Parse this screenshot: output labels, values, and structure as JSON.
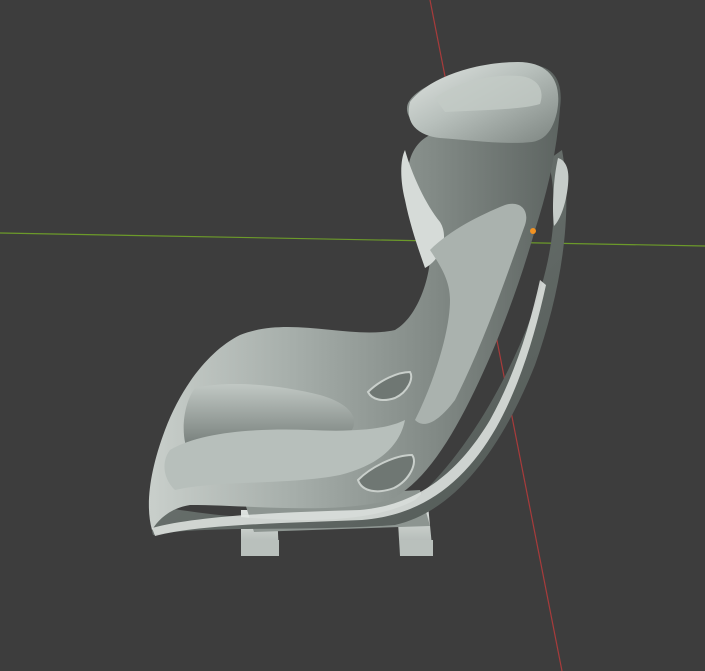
{
  "viewport": {
    "background_color": "#3d3d3d",
    "x_axis_color": "#a83b3b",
    "y_axis_color": "#6c9a2a",
    "origin_color": "#f29222"
  },
  "object": {
    "type": "racing-seat-mesh",
    "shading": "solid",
    "base_color": "#9ea6a2",
    "shadow_color": "#5f6663",
    "highlight_color": "#d9ddda"
  }
}
